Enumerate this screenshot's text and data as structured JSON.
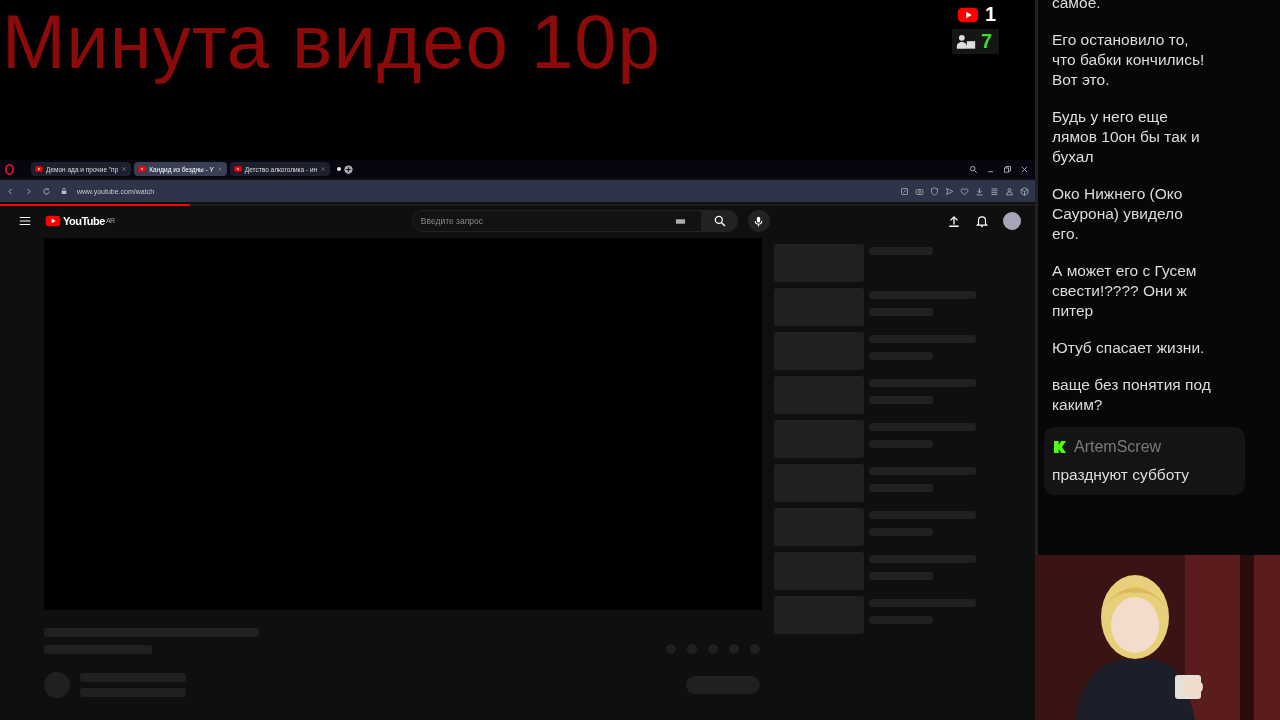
{
  "overlay": {
    "title": "Минута видео 10р",
    "stats": [
      {
        "kind": "youtube",
        "value": "1"
      },
      {
        "kind": "viewers",
        "value": "7"
      }
    ]
  },
  "browser": {
    "tabs": [
      {
        "label": "Демон ада и прочие \"пр",
        "selected": false
      },
      {
        "label": "Кандид из бездны - Y",
        "selected": true
      },
      {
        "label": "Детство алкоголика - ин",
        "selected": false
      }
    ],
    "address": "www.youtube.com/watch",
    "youtube": {
      "logo": "YouTube",
      "region": "AR",
      "search": {
        "placeholder": "Введите запрос"
      }
    }
  },
  "chat": {
    "messages": [
      {
        "text": "самое.",
        "highlighted": false
      },
      {
        "text": "Его остановило то, что бабки кончились! Вот это.",
        "highlighted": false
      },
      {
        "text": "Будь у него еще лямов 10он бы так и бухал",
        "highlighted": false
      },
      {
        "text": "Око Нижнего (Око Саурона) увидело его.",
        "highlighted": false
      },
      {
        "text": "А может его с Гусем свести!???? Они ж питер",
        "highlighted": false
      },
      {
        "text": "Ютуб спасает жизни.",
        "highlighted": false
      },
      {
        "text": "ваще без понятия под каким?",
        "highlighted": false
      },
      {
        "author": "ArtemScrew",
        "text": "празднуют субботу",
        "highlighted": true
      }
    ]
  }
}
